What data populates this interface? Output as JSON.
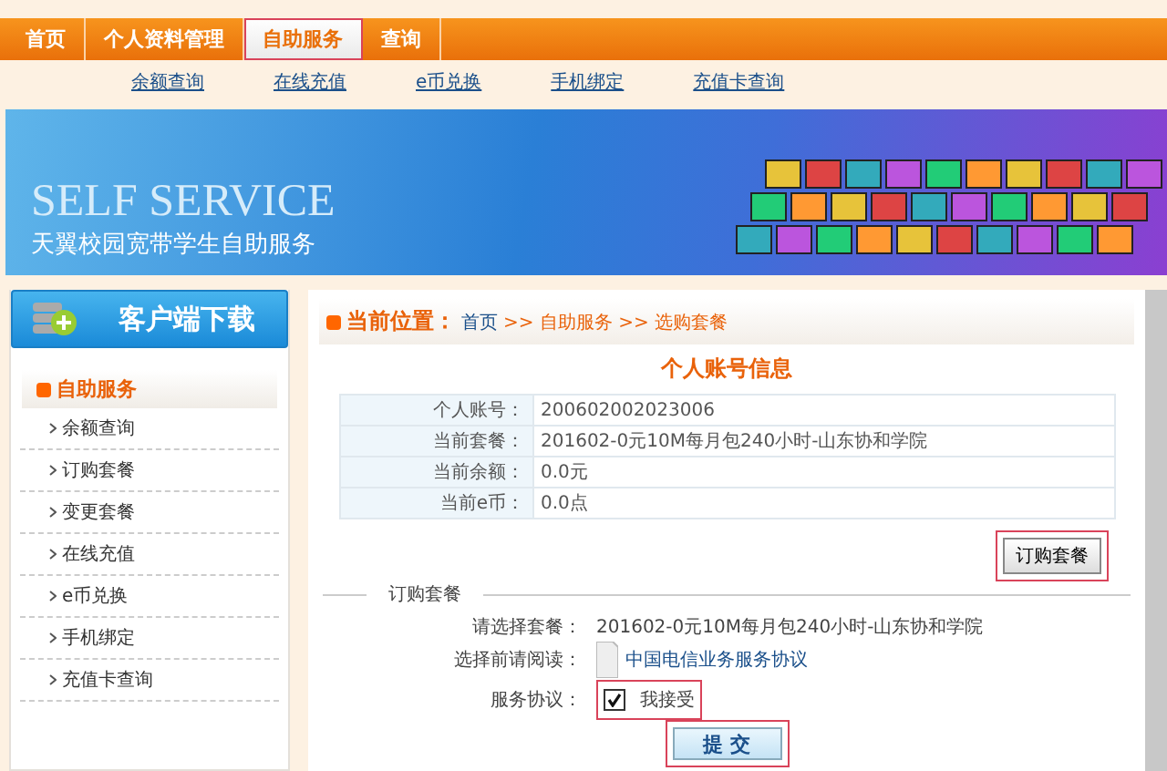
{
  "nav": {
    "tabs": [
      {
        "label": "首页",
        "selected": false,
        "highlighted": false
      },
      {
        "label": "个人资料管理",
        "selected": false,
        "highlighted": false
      },
      {
        "label": "自助服务",
        "selected": true,
        "highlighted": true
      },
      {
        "label": "查询",
        "selected": false,
        "highlighted": false
      }
    ],
    "sub_links": [
      "余额查询",
      "在线充值",
      "e币兑换",
      "手机绑定",
      "充值卡查询"
    ]
  },
  "banner": {
    "title": "SELF SERVICE",
    "subtitle": "天翼校园宽带学生自助服务"
  },
  "sidebar": {
    "download_button": "客户端下载",
    "section_title": "自助服务",
    "items": [
      "余额查询",
      "订购套餐",
      "变更套餐",
      "在线充值",
      "e币兑换",
      "手机绑定",
      "充值卡查询"
    ]
  },
  "breadcrumb": {
    "label": "当前位置：",
    "home": "首页",
    "path": ">> 自助服务 >> 选购套餐"
  },
  "account": {
    "title": "个人账号信息",
    "rows": [
      {
        "label": "个人账号：",
        "value": "200602002023006"
      },
      {
        "label": "当前套餐：",
        "value": "201602-0元10M每月包240小时-山东协和学院"
      },
      {
        "label": "当前余额：",
        "value": "0.0元"
      },
      {
        "label": "当前e币：",
        "value": "0.0点"
      }
    ],
    "order_button": {
      "label": "订购套餐",
      "highlighted": true
    }
  },
  "order": {
    "legend": "订购套餐",
    "package_label": "请选择套餐：",
    "package_value": "201602-0元10M每月包240小时-山东协和学院",
    "read_label": "选择前请阅读：",
    "agreement_link": "中国电信业务服务协议",
    "agree_label": "服务协议：",
    "agree_text": "我接受",
    "checked": true,
    "agree_highlighted": true,
    "submit": {
      "label": "提 交",
      "highlighted": true
    }
  }
}
